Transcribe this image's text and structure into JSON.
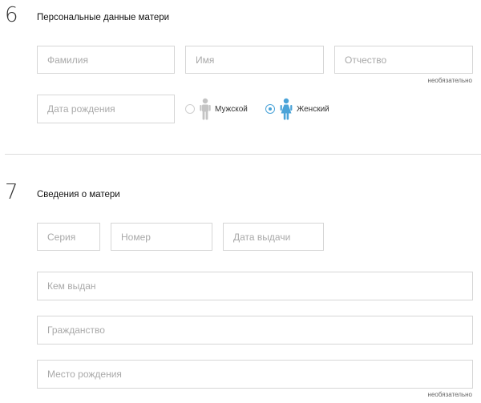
{
  "section6": {
    "number": "6",
    "title": "Персональные данные матери",
    "fields": {
      "surname_placeholder": "Фамилия",
      "name_placeholder": "Имя",
      "patronymic_placeholder": "Отчество",
      "birthdate_placeholder": "Дата рождения"
    },
    "optional_hint": "необязательно",
    "gender": {
      "male_label": "Мужской",
      "female_label": "Женский",
      "selected": "female"
    }
  },
  "section7": {
    "number": "7",
    "title": "Сведения о матери",
    "fields": {
      "series_placeholder": "Серия",
      "number_placeholder": "Номер",
      "issue_date_placeholder": "Дата выдачи",
      "issued_by_placeholder": "Кем выдан",
      "citizenship_placeholder": "Гражданство",
      "birthplace_placeholder": "Место рождения"
    },
    "optional_hint": "необязательно"
  },
  "icons": {
    "male": "male-person-icon",
    "female": "female-person-icon"
  },
  "colors": {
    "accent": "#4aa3d8",
    "icon_inactive": "#c4c4c4",
    "border": "#d6d6d6"
  }
}
